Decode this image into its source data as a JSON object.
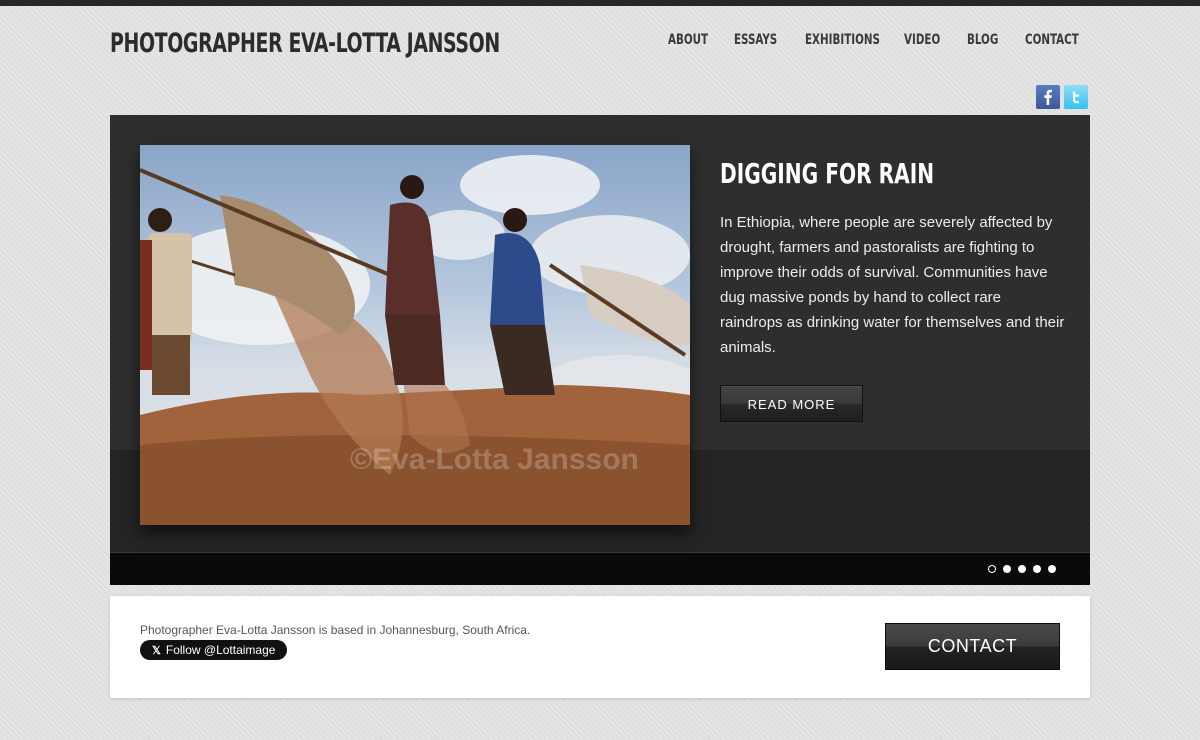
{
  "site": {
    "title": "PHOTOGRAPHER EVA-LOTTA JANSSON"
  },
  "nav": {
    "items": [
      "ABOUT",
      "ESSAYS",
      "EXHIBITIONS",
      "VIDEO",
      "BLOG",
      "CONTACT"
    ]
  },
  "social": {
    "facebook_icon": "facebook-icon",
    "twitter_icon": "twitter-icon"
  },
  "slider": {
    "watermark": "©Eva-Lotta Jansson",
    "slide_title": "DIGGING FOR RAIN",
    "slide_description": "In Ethiopia, where people are severely affected by drought, farmers and pastoralists are fighting to improve their odds of survival. Communities have dug massive ponds by hand to collect rare raindrops as drinking water for themselves and their animals.",
    "read_more_label": "READ MORE",
    "dots": 5,
    "active_dot": 0
  },
  "footer": {
    "about_text": "Photographer Eva-Lotta Jansson is based in Johannesburg, South Africa.",
    "follow_label": "Follow @Lottaimage",
    "contact_label": "CONTACT"
  },
  "colors": {
    "background": "#e2e2e2",
    "slider_bg": "#2e2e2e",
    "text_dark": "#2c2c2c",
    "facebook": "#3b5998",
    "twitter": "#33c2f0"
  }
}
